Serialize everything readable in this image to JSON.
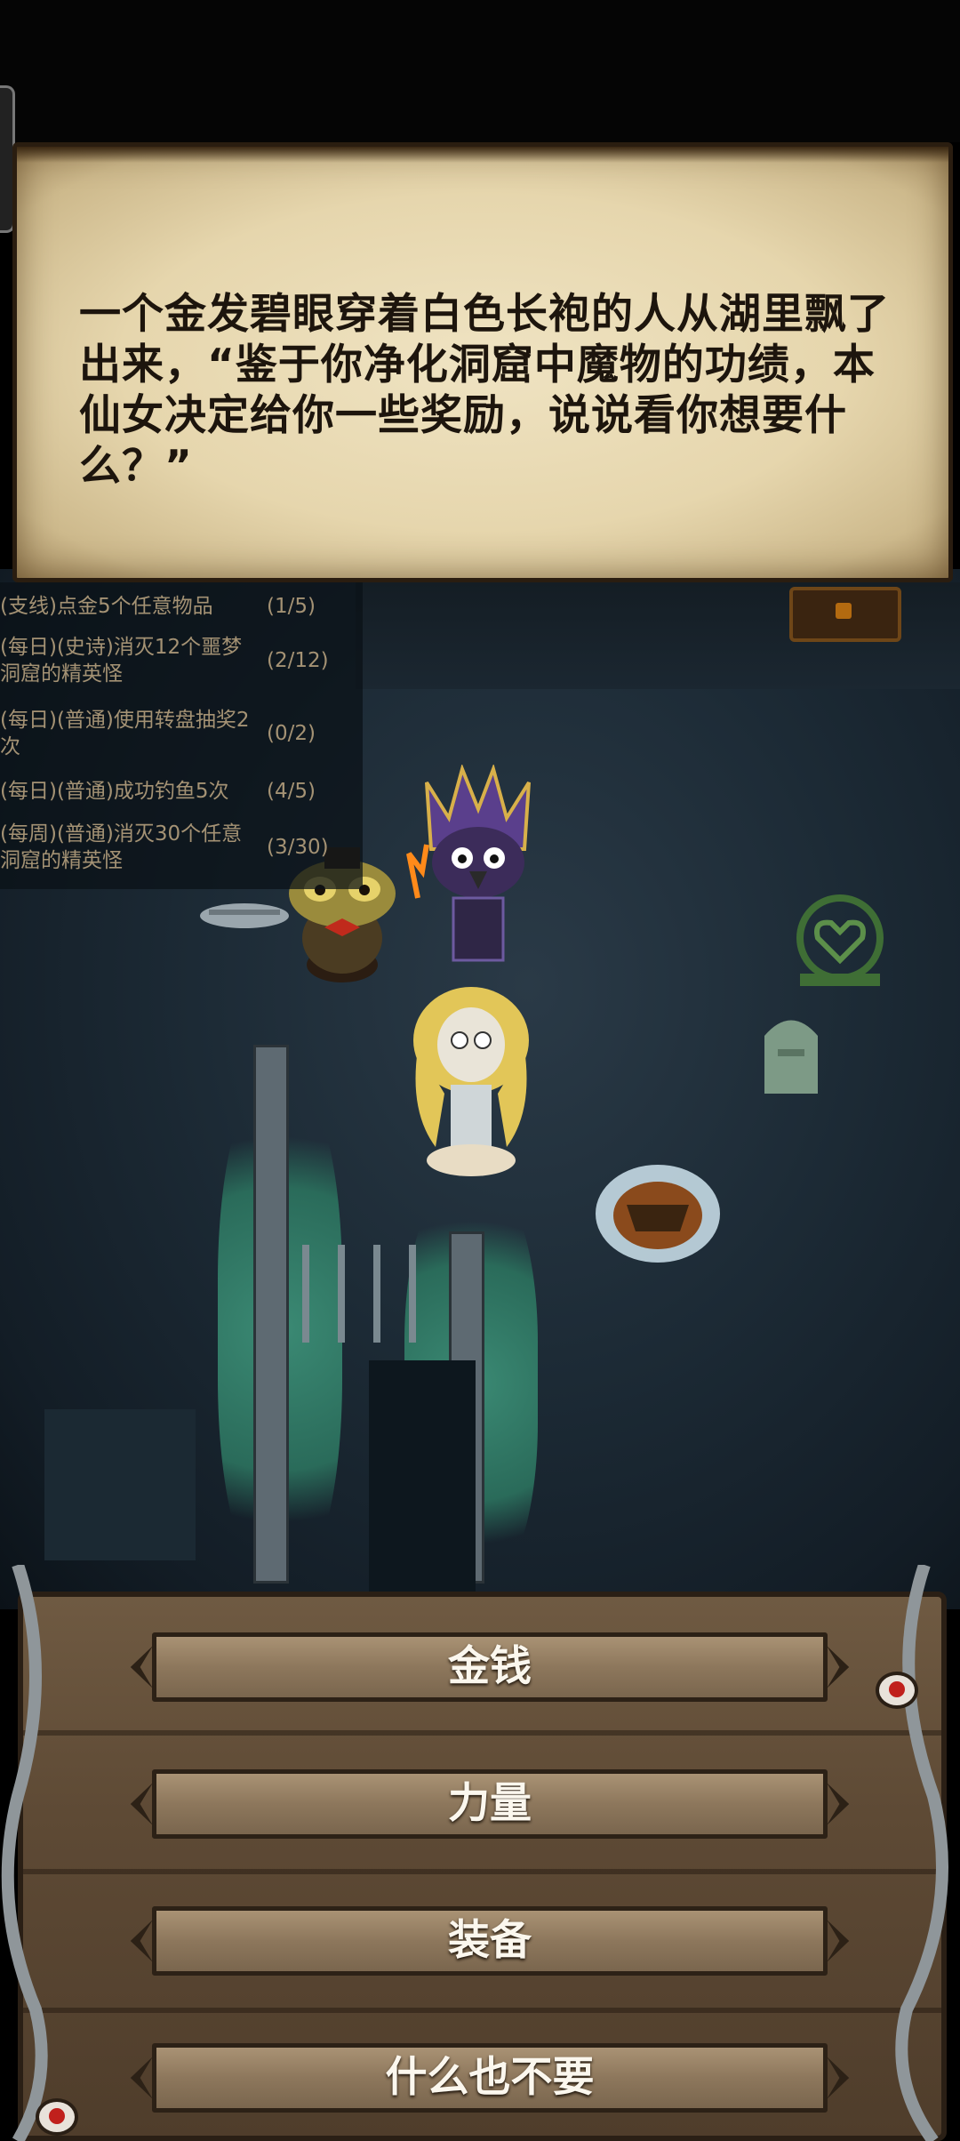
{
  "dialog": {
    "text": "一个金发碧眼穿着白色长袍的人从湖里飘了出来，“鉴于你净化洞窟中魔物的功绩，本仙女决定给你一些奖励，说说看你想要什么？”"
  },
  "quests": [
    {
      "title": "(支线)点金5个任意物品",
      "progress": "(1/5)"
    },
    {
      "title": "(每日)(史诗)消灭12个噩梦洞窟的精英怪",
      "progress": "(2/12)"
    },
    {
      "title": "(每日)(普通)使用转盘抽奖2次",
      "progress": "(0/2)"
    },
    {
      "title": "(每日)(普通)成功钓鱼5次",
      "progress": "(4/5)"
    },
    {
      "title": "(每周)(普通)消灭30个任意洞窟的精英怪",
      "progress": "(3/30)"
    }
  ],
  "options": [
    {
      "label": "金钱"
    },
    {
      "label": "力量"
    },
    {
      "label": "装备"
    },
    {
      "label": "什么也不要"
    }
  ],
  "colors": {
    "parchment": "#e6d6ad",
    "wood": "#5e4a35",
    "button": "#8d775c",
    "quest_text": "#a49274"
  }
}
